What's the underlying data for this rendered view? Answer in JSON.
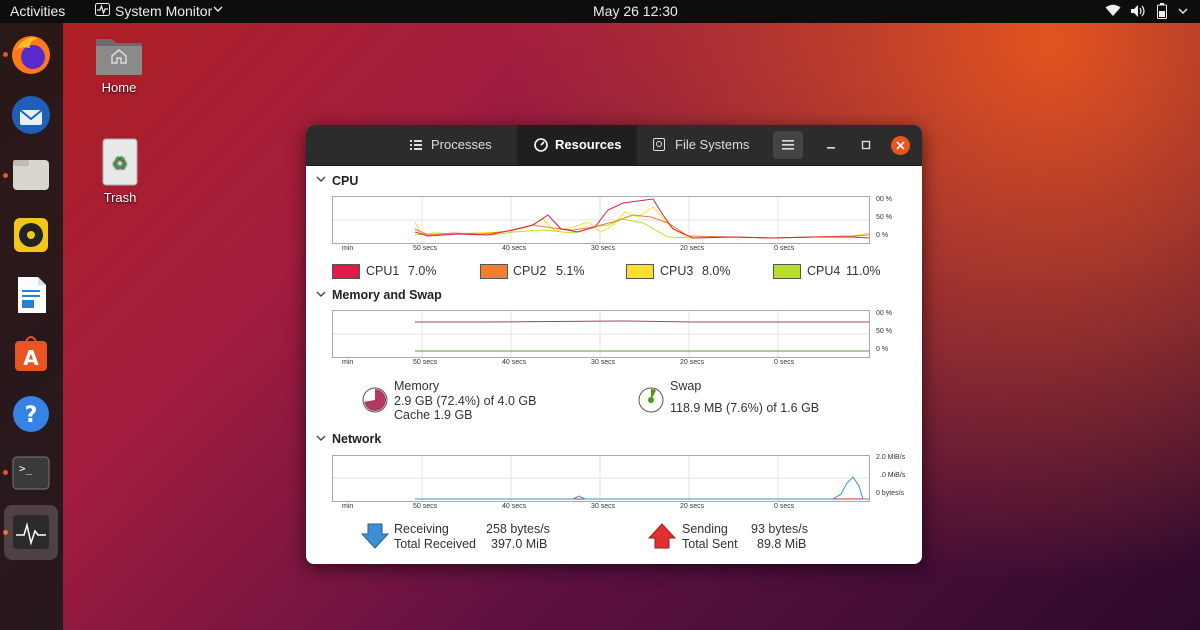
{
  "topbar": {
    "activities": "Activities",
    "app_menu": "System Monitor",
    "datetime": "May 26  12:30"
  },
  "desktop": {
    "home_label": "Home",
    "trash_label": "Trash"
  },
  "window": {
    "tabs": [
      {
        "label": "Processes"
      },
      {
        "label": "Resources"
      },
      {
        "label": "File Systems"
      }
    ],
    "active_tab": "Resources",
    "cpu": {
      "title": "CPU",
      "y_ticks": [
        "00 %",
        "50 %",
        "0 %"
      ],
      "x_ticks": [
        "min",
        "50 secs",
        "40 secs",
        "30 secs",
        "20 secs",
        "0 secs"
      ],
      "legend": [
        {
          "name": "CPU1",
          "value": "7.0%",
          "color": "#e01b4c"
        },
        {
          "name": "CPU2",
          "value": "5.1%",
          "color": "#f08030"
        },
        {
          "name": "CPU3",
          "value": "8.0%",
          "color": "#f8e12a"
        },
        {
          "name": "CPU4",
          "value": "11.0%",
          "color": "#b8e02a"
        }
      ]
    },
    "memory": {
      "title": "Memory and Swap",
      "y_ticks": [
        "00 %",
        "50 %",
        "0 %"
      ],
      "x_ticks": [
        "min",
        "50 secs",
        "40 secs",
        "30 secs",
        "20 secs",
        "0 secs"
      ],
      "mem_label": "Memory",
      "mem_value": "2.9 GB (72.4%) of 4.0 GB",
      "mem_cache": "Cache 1.9 GB",
      "mem_fraction": 0.724,
      "swap_label": "Swap",
      "swap_value": "118.9 MB (7.6%) of 1.6 GB",
      "swap_fraction": 0.076
    },
    "network": {
      "title": "Network",
      "y_ticks": [
        "2.0 MiB/s",
        ".0 MiB/s",
        "0 bytes/s"
      ],
      "x_ticks": [
        "min",
        "50 secs",
        "40 secs",
        "30 secs",
        "20 secs",
        "0 secs"
      ],
      "receiving_label": "Receiving",
      "receiving_value": "258 bytes/s",
      "total_received_label": "Total Received",
      "total_received_value": "397.0 MiB",
      "sending_label": "Sending",
      "sending_value": "93 bytes/s",
      "total_sent_label": "Total Sent",
      "total_sent_value": "89.8 MiB"
    }
  }
}
